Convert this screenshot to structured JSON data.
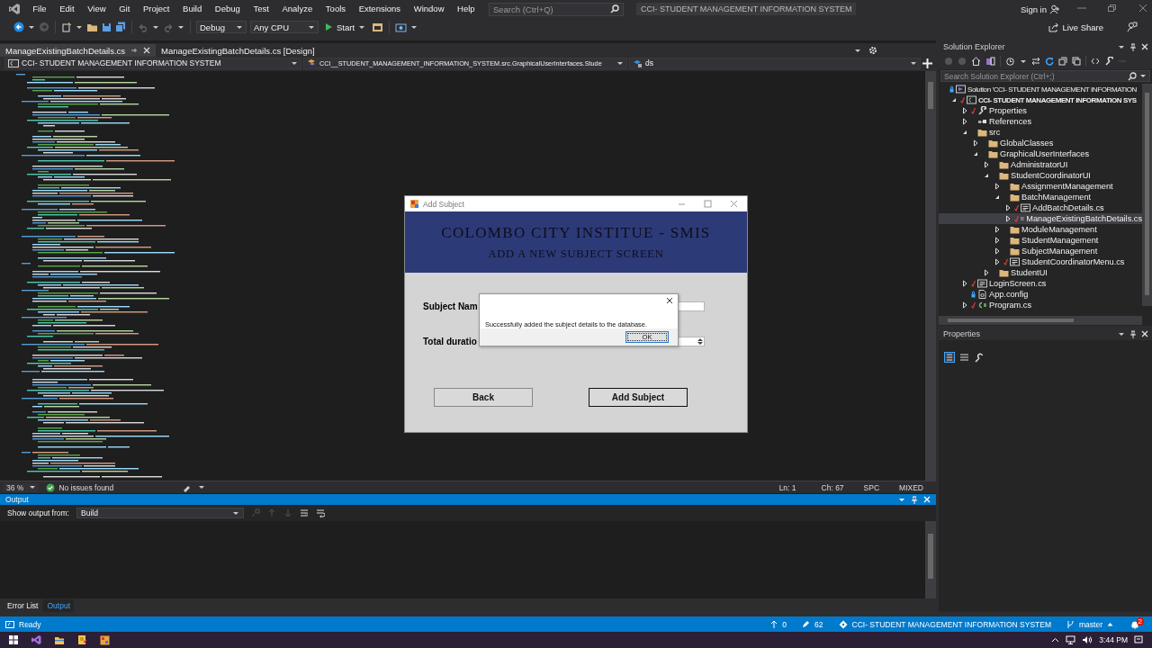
{
  "menu": [
    {
      "label": "File"
    },
    {
      "label": "Edit"
    },
    {
      "label": "View"
    },
    {
      "label": "Git"
    },
    {
      "label": "Project"
    },
    {
      "label": "Build"
    },
    {
      "label": "Debug"
    },
    {
      "label": "Test"
    },
    {
      "label": "Analyze"
    },
    {
      "label": "Tools"
    },
    {
      "label": "Extensions"
    },
    {
      "label": "Window"
    },
    {
      "label": "Help"
    }
  ],
  "search": {
    "placeholder": "Search (Ctrl+Q)"
  },
  "window": {
    "title": "CCI- STUDENT MANAGEMENT INFORMATION SYSTEM"
  },
  "account": {
    "sign_in": "Sign in"
  },
  "toolbar": {
    "configuration": "Debug",
    "platform": "Any CPU",
    "start": "Start",
    "live_share": "Live Share"
  },
  "editor": {
    "tabs": [
      {
        "label": "ManageExistingBatchDetails.cs",
        "selected": true
      },
      {
        "label": "ManageExistingBatchDetails.cs [Design]",
        "selected": false
      }
    ],
    "project_dropdown": "CCI- STUDENT MANAGEMENT INFORMATION SYSTEM",
    "type_dropdown": "CCI__STUDENT_MANAGEMENT_INFORMATION_SYSTEM.src.GraphicalUserInterfaces.Stude",
    "member_dropdown": "ds",
    "zoom": "36 %",
    "issues": "No issues found",
    "line": "Ln: 1",
    "column": "Ch: 67",
    "whitespace": "SPC",
    "line_endings": "MIXED"
  },
  "form": {
    "title": "Add Subject",
    "heading": "COLOMBO CITY INSTITUE - SMIS",
    "subheading": "ADD A NEW SUBJECT SCREEN",
    "fields": [
      {
        "label": "Subject Nam",
        "kind": "text"
      },
      {
        "label": "Total duratio",
        "kind": "number"
      }
    ],
    "buttons": [
      {
        "label": "Back",
        "default": false
      },
      {
        "label": "Add Subject",
        "default": true
      }
    ]
  },
  "message_box": {
    "text": "Successfully added the subject details to the database.",
    "buttons": [
      {
        "label": "OK",
        "focused": true
      }
    ]
  },
  "output": {
    "title": "Output",
    "source_label": "Show output from:",
    "source": "Build"
  },
  "bottom_tabs": [
    {
      "label": "Error List",
      "selected": false
    },
    {
      "label": "Output",
      "selected": true
    }
  ],
  "solution_explorer": {
    "title": "Solution Explorer",
    "search": {
      "placeholder": "Search Solution Explorer (Ctrl+;)"
    },
    "tree": [
      {
        "label": "Solution 'CCI- STUDENT MANAGEMENT INFORMATION",
        "kind": "solution",
        "tracked": false,
        "locked": true,
        "selected": false,
        "children": [
          {
            "label": "CCI- STUDENT MANAGEMENT INFORMATION SYS",
            "kind": "project",
            "tracked": true,
            "locked": false,
            "expanded": true,
            "selected": false,
            "children": [
              {
                "label": "Properties",
                "kind": "properties",
                "tracked": true,
                "locked": false,
                "expanded": false,
                "selected": false
              },
              {
                "label": "References",
                "kind": "references",
                "tracked": false,
                "locked": false,
                "expanded": false,
                "selected": false
              },
              {
                "label": "src",
                "kind": "folder",
                "tracked": false,
                "locked": false,
                "expanded": true,
                "selected": false,
                "children": [
                  {
                    "label": "GlobalClasses",
                    "kind": "folder",
                    "tracked": false,
                    "locked": false,
                    "expanded": false,
                    "selected": false
                  },
                  {
                    "label": "GraphicalUserInterfaces",
                    "kind": "folder",
                    "tracked": false,
                    "locked": false,
                    "expanded": true,
                    "selected": false,
                    "children": [
                      {
                        "label": "AdministratorUI",
                        "kind": "folder",
                        "tracked": false,
                        "locked": false,
                        "expanded": false,
                        "selected": false
                      },
                      {
                        "label": "StudentCoordinatorUI",
                        "kind": "folder",
                        "tracked": false,
                        "locked": false,
                        "expanded": true,
                        "selected": false,
                        "children": [
                          {
                            "label": "AssignmentManagement",
                            "kind": "folder",
                            "tracked": false,
                            "locked": false,
                            "expanded": false,
                            "selected": false
                          },
                          {
                            "label": "BatchManagement",
                            "kind": "folder",
                            "tracked": false,
                            "locked": false,
                            "expanded": true,
                            "selected": false,
                            "children": [
                              {
                                "label": "AddBatchDetails.cs",
                                "kind": "form",
                                "tracked": true,
                                "locked": false,
                                "expanded": false,
                                "selected": false
                              },
                              {
                                "label": "ManageExistingBatchDetails.cs",
                                "kind": "form",
                                "tracked": true,
                                "locked": false,
                                "expanded": false,
                                "selected": true
                              }
                            ]
                          },
                          {
                            "label": "ModuleManagement",
                            "kind": "folder",
                            "tracked": false,
                            "locked": false,
                            "expanded": false,
                            "selected": false
                          },
                          {
                            "label": "StudentManagement",
                            "kind": "folder",
                            "tracked": false,
                            "locked": false,
                            "expanded": false,
                            "selected": false
                          },
                          {
                            "label": "SubjectManagement",
                            "kind": "folder",
                            "tracked": false,
                            "locked": false,
                            "expanded": false,
                            "selected": false
                          },
                          {
                            "label": "StudentCoordinatorMenu.cs",
                            "kind": "form",
                            "tracked": true,
                            "locked": false,
                            "expanded": false,
                            "selected": false
                          }
                        ]
                      },
                      {
                        "label": "StudentUI",
                        "kind": "folder",
                        "tracked": false,
                        "locked": false,
                        "expanded": false,
                        "selected": false
                      }
                    ]
                  }
                ]
              },
              {
                "label": "LoginScreen.cs",
                "kind": "form",
                "tracked": true,
                "locked": false,
                "expanded": false,
                "selected": false
              },
              {
                "label": "App.config",
                "kind": "config",
                "tracked": false,
                "locked": true,
                "selected": false
              },
              {
                "label": "Program.cs",
                "kind": "csharp",
                "tracked": true,
                "locked": false,
                "expanded": false,
                "selected": false
              }
            ]
          }
        ]
      }
    ]
  },
  "properties": {
    "title": "Properties"
  },
  "status_bar": {
    "text": "Ready",
    "incoming": "0",
    "changes": "62",
    "repository": "CCI- STUDENT MANAGEMENT INFORMATION SYSTEM",
    "branch": "master",
    "notifications": "2"
  },
  "taskbar": {
    "time": "3:44 PM"
  }
}
